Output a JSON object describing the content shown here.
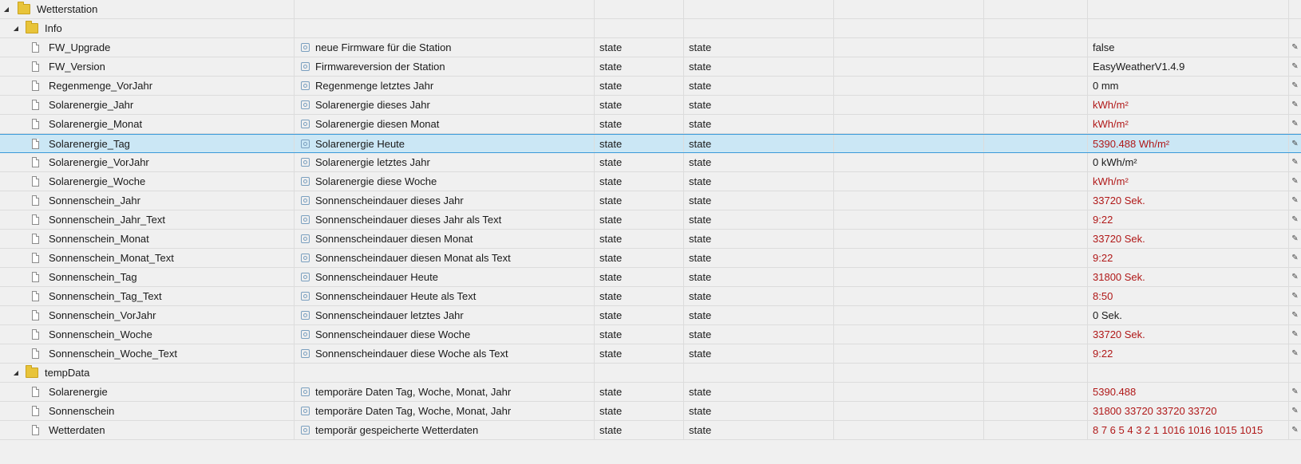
{
  "tree": {
    "root": {
      "label": "Wetterstation",
      "expander": "◢"
    },
    "info_folder": {
      "label": "Info",
      "expander": "◢"
    },
    "info_rows": [
      {
        "id": "FW_Upgrade",
        "name": "neue Firmware für die Station",
        "type": "state",
        "role": "state",
        "value": "false",
        "value_red": false
      },
      {
        "id": "FW_Version",
        "name": "Firmwareversion der Station",
        "type": "state",
        "role": "state",
        "value": "EasyWeatherV1.4.9",
        "value_red": false
      },
      {
        "id": "Regenmenge_VorJahr",
        "name": "Regenmenge letztes Jahr",
        "type": "state",
        "role": "state",
        "value": "0 mm",
        "value_red": false
      },
      {
        "id": "Solarenergie_Jahr",
        "name": "Solarenergie dieses Jahr",
        "type": "state",
        "role": "state",
        "value": "kWh/m²",
        "value_red": true
      },
      {
        "id": "Solarenergie_Monat",
        "name": "Solarenergie diesen Monat",
        "type": "state",
        "role": "state",
        "value": "kWh/m²",
        "value_red": true
      },
      {
        "id": "Solarenergie_Tag",
        "name": "Solarenergie Heute",
        "type": "state",
        "role": "state",
        "value": "5390.488 Wh/m²",
        "value_red": true,
        "selected": true
      },
      {
        "id": "Solarenergie_VorJahr",
        "name": "Solarenergie letztes Jahr",
        "type": "state",
        "role": "state",
        "value": "0 kWh/m²",
        "value_red": false
      },
      {
        "id": "Solarenergie_Woche",
        "name": "Solarenergie diese Woche",
        "type": "state",
        "role": "state",
        "value": "kWh/m²",
        "value_red": true
      },
      {
        "id": "Sonnenschein_Jahr",
        "name": "Sonnenscheindauer dieses Jahr",
        "type": "state",
        "role": "state",
        "value": "33720 Sek.",
        "value_red": true
      },
      {
        "id": "Sonnenschein_Jahr_Text",
        "name": "Sonnenscheindauer dieses Jahr als Text",
        "type": "state",
        "role": "state",
        "value": "9:22",
        "value_red": true
      },
      {
        "id": "Sonnenschein_Monat",
        "name": "Sonnenscheindauer diesen Monat",
        "type": "state",
        "role": "state",
        "value": "33720 Sek.",
        "value_red": true
      },
      {
        "id": "Sonnenschein_Monat_Text",
        "name": "Sonnenscheindauer diesen Monat als Text",
        "type": "state",
        "role": "state",
        "value": "9:22",
        "value_red": true
      },
      {
        "id": "Sonnenschein_Tag",
        "name": "Sonnenscheindauer Heute",
        "type": "state",
        "role": "state",
        "value": "31800 Sek.",
        "value_red": true
      },
      {
        "id": "Sonnenschein_Tag_Text",
        "name": "Sonnenscheindauer Heute als Text",
        "type": "state",
        "role": "state",
        "value": "8:50",
        "value_red": true
      },
      {
        "id": "Sonnenschein_VorJahr",
        "name": "Sonnenscheindauer letztes Jahr",
        "type": "state",
        "role": "state",
        "value": "0 Sek.",
        "value_red": false
      },
      {
        "id": "Sonnenschein_Woche",
        "name": "Sonnenscheindauer diese Woche",
        "type": "state",
        "role": "state",
        "value": "33720 Sek.",
        "value_red": true
      },
      {
        "id": "Sonnenschein_Woche_Text",
        "name": "Sonnenscheindauer diese Woche als Text",
        "type": "state",
        "role": "state",
        "value": "9:22",
        "value_red": true
      }
    ],
    "temp_folder": {
      "label": "tempData",
      "expander": "◢"
    },
    "temp_rows": [
      {
        "id": "Solarenergie",
        "name": "temporäre Daten Tag, Woche, Monat, Jahr",
        "type": "state",
        "role": "state",
        "value": "5390.488",
        "value_red": true
      },
      {
        "id": "Sonnenschein",
        "name": "temporäre Daten Tag, Woche, Monat, Jahr",
        "type": "state",
        "role": "state",
        "value": "31800 33720 33720 33720",
        "value_red": true
      },
      {
        "id": "Wetterdaten",
        "name": "temporär gespeicherte Wetterdaten",
        "type": "state",
        "role": "state",
        "value": "8 7 6 5 4 3 2 1 1016 1016 1015 1015",
        "value_red": true
      }
    ]
  },
  "colors": {
    "selected_bg": "#cbe7f5",
    "selected_border": "#3b9ad9",
    "value_red": "#b01818"
  },
  "icons": {
    "folder": "folder-icon",
    "file": "file-icon",
    "state": "state-icon",
    "edit": "edit-pencil-icon",
    "edit_glyph": "✎"
  }
}
